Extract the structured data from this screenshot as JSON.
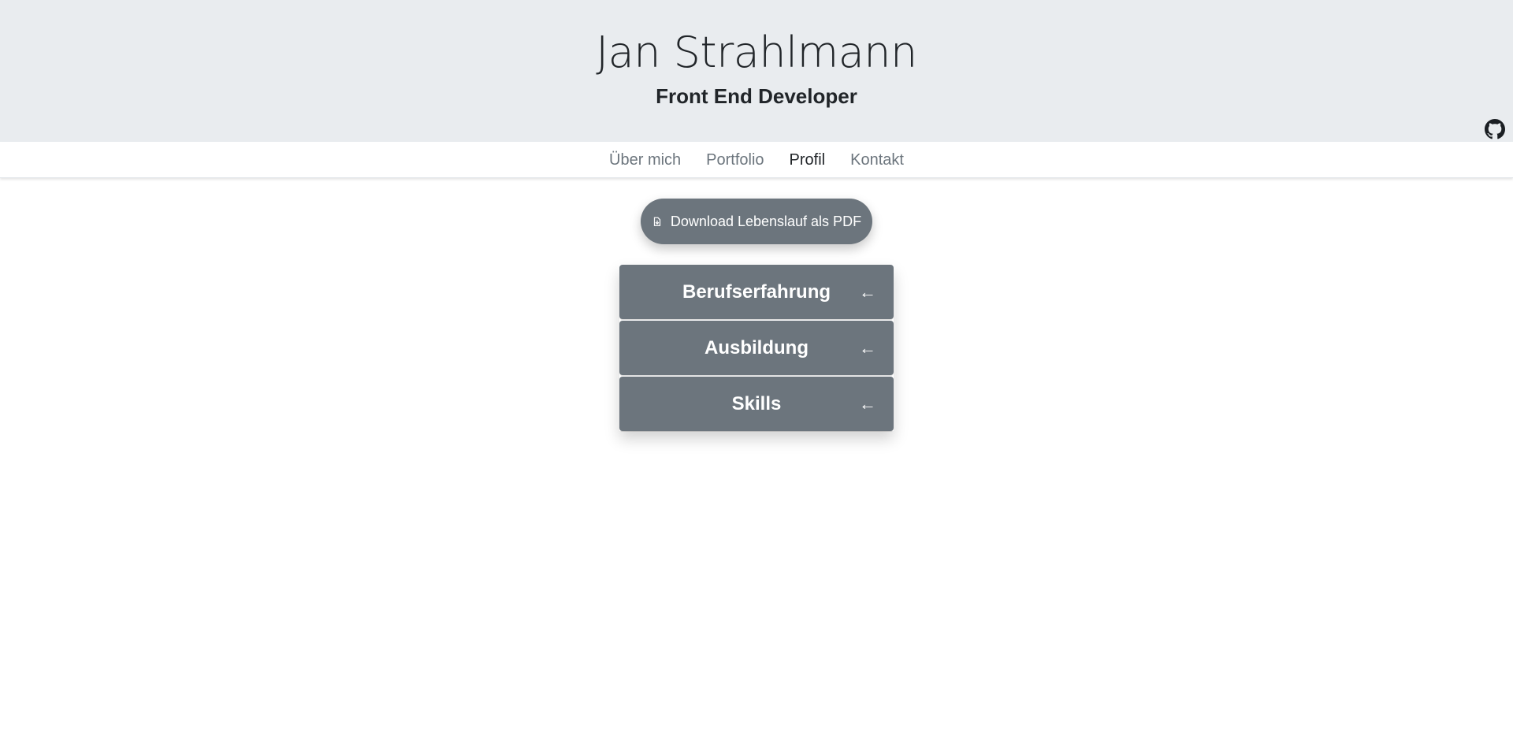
{
  "header": {
    "name": "Jan Strahlmann",
    "role": "Front End Developer",
    "github_icon": "github-icon"
  },
  "nav": {
    "items": [
      {
        "label": "Über mich",
        "active": false
      },
      {
        "label": "Portfolio",
        "active": false
      },
      {
        "label": "Profil",
        "active": true
      },
      {
        "label": "Kontakt",
        "active": false
      }
    ]
  },
  "main": {
    "download_label": "Download Lebenslauf als PDF",
    "download_icon": "file-download-icon",
    "sections": [
      {
        "title": "Berufserfahrung",
        "arrow": "←"
      },
      {
        "title": "Ausbildung",
        "arrow": "←"
      },
      {
        "title": "Skills",
        "arrow": "←"
      }
    ]
  },
  "colors": {
    "header_bg": "#e9ecef",
    "accent_gray": "#6c757d",
    "text_dark": "#212529"
  }
}
